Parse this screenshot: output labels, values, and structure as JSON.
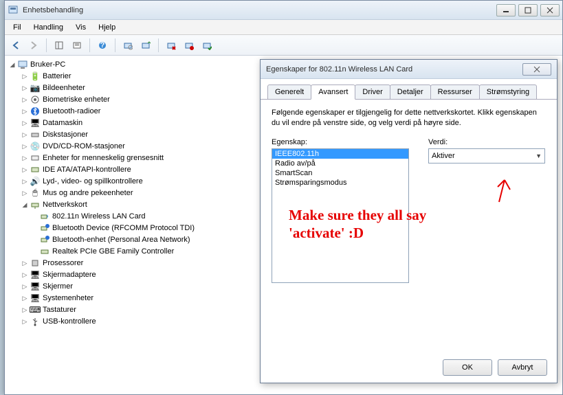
{
  "window": {
    "title": "Enhetsbehandling"
  },
  "menu": {
    "file": "Fil",
    "action": "Handling",
    "view": "Vis",
    "help": "Hjelp"
  },
  "tree": {
    "root": "Bruker-PC",
    "items": [
      {
        "label": "Batterier"
      },
      {
        "label": "Bildeenheter"
      },
      {
        "label": "Biometriske enheter"
      },
      {
        "label": "Bluetooth-radioer"
      },
      {
        "label": "Datamaskin"
      },
      {
        "label": "Diskstasjoner"
      },
      {
        "label": "DVD/CD-ROM-stasjoner"
      },
      {
        "label": "Enheter for menneskelig grensesnitt"
      },
      {
        "label": "IDE ATA/ATAPI-kontrollere"
      },
      {
        "label": "Lyd-, video- og spillkontrollere"
      },
      {
        "label": "Mus og andre pekeenheter"
      },
      {
        "label": "Nettverkskort"
      },
      {
        "label": "Prosessorer"
      },
      {
        "label": "Skjermadaptere"
      },
      {
        "label": "Skjermer"
      },
      {
        "label": "Systemenheter"
      },
      {
        "label": "Tastaturer"
      },
      {
        "label": "USB-kontrollere"
      }
    ],
    "net_children": [
      {
        "label": "802.11n Wireless LAN Card"
      },
      {
        "label": "Bluetooth Device (RFCOMM Protocol TDI)"
      },
      {
        "label": "Bluetooth-enhet (Personal Area Network)"
      },
      {
        "label": "Realtek PCIe GBE Family Controller"
      }
    ]
  },
  "dialog": {
    "title": "Egenskaper for 802.11n Wireless LAN Card",
    "tabs": {
      "general": "Generelt",
      "advanced": "Avansert",
      "driver": "Driver",
      "details": "Detaljer",
      "resources": "Ressurser",
      "power": "Strømstyring"
    },
    "instructions": "Følgende egenskaper er tilgjengelig for dette nettverkskortet. Klikk egenskapen du vil endre på venstre side, og velg verdi på høyre side.",
    "property_label": "Egenskap:",
    "value_label": "Verdi:",
    "properties": [
      "IEEE802.11h",
      "Radio av/på",
      "SmartScan",
      "Strømsparingsmodus"
    ],
    "selected_value": "Aktiver",
    "ok": "OK",
    "cancel": "Avbryt"
  },
  "annotation": {
    "text": "Make sure they all say 'activate' :D"
  }
}
